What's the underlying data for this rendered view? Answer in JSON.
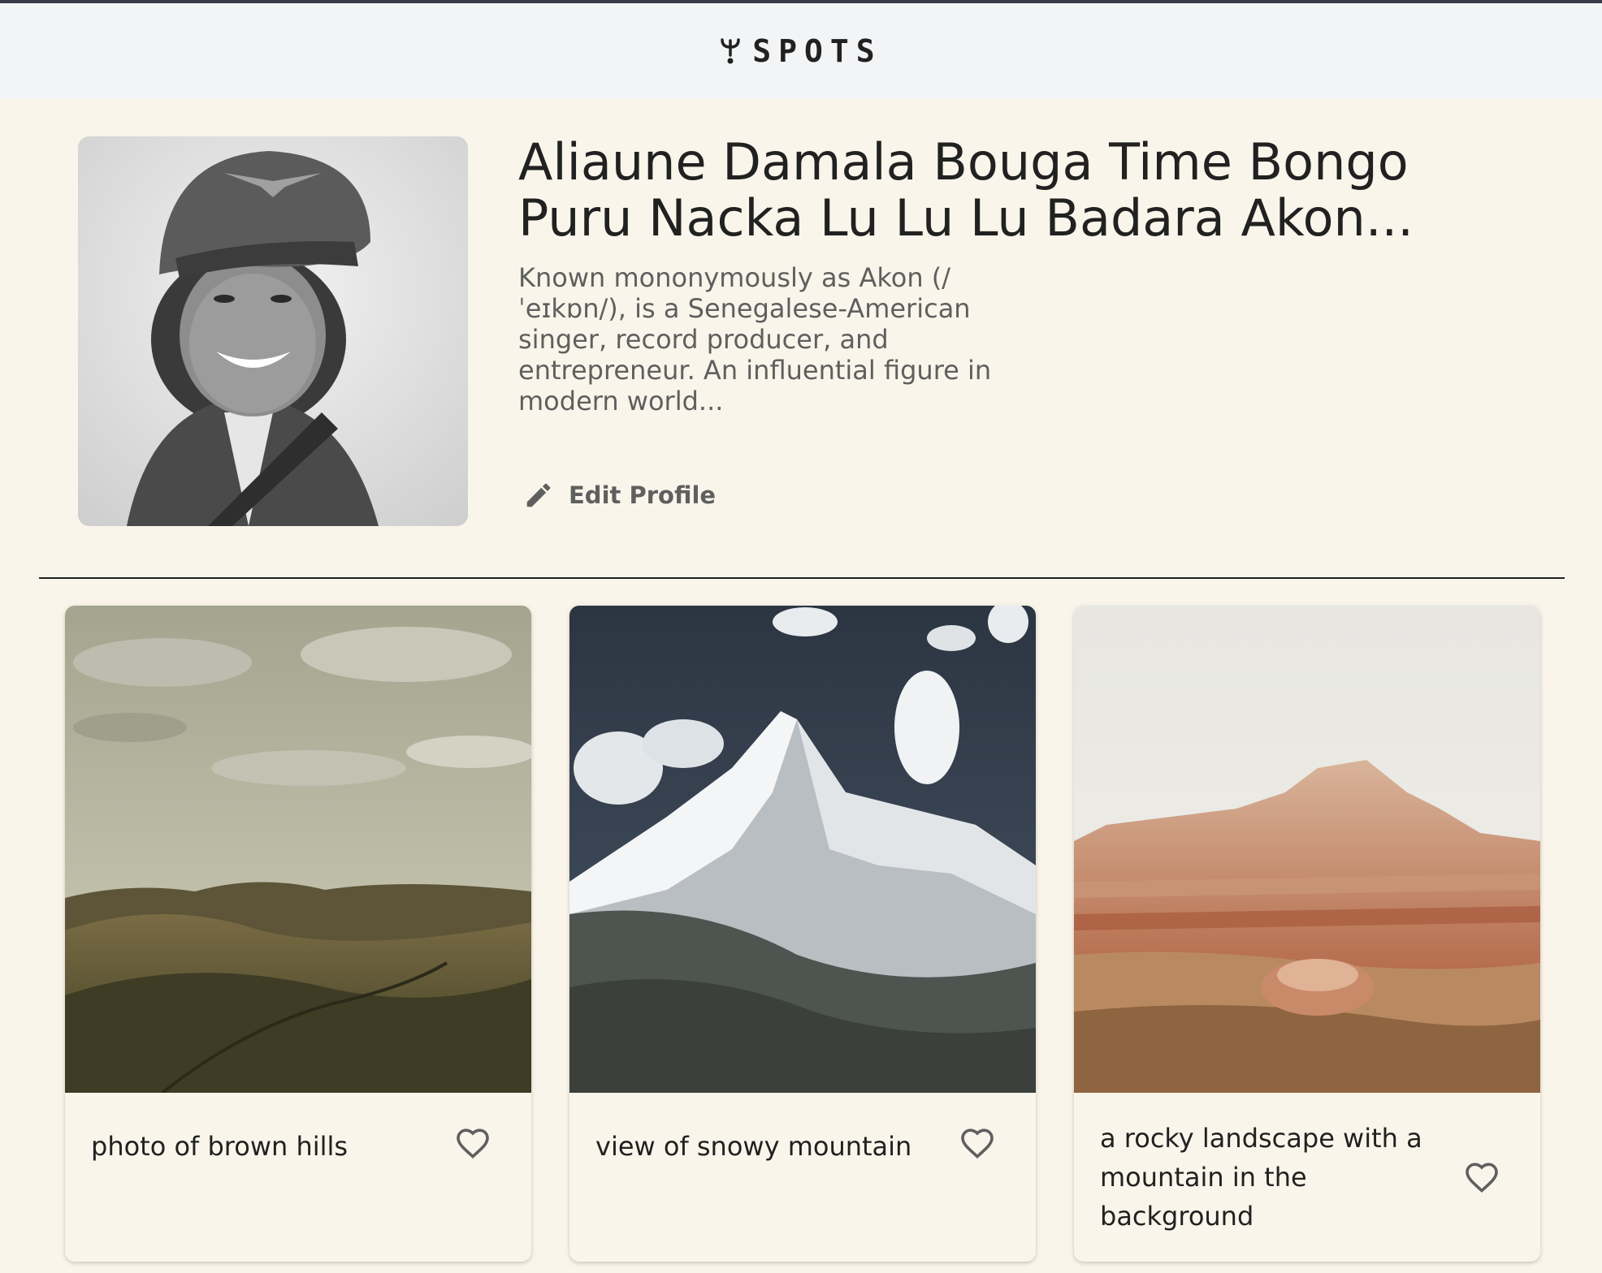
{
  "app": {
    "logo_text": "SPOTS",
    "logo_icon": "sprout-arrow-icon"
  },
  "profile": {
    "name": "Aliaune Damala Bouga Time Bongo Puru Nacka Lu Lu Lu Badara Akon...",
    "bio": "Known mononymously as Akon (/ˈeɪkɒn/), is a Senegalese-American singer, record producer, and entrepreneur. An influential figure in modern world...",
    "edit_label": "Edit Profile",
    "edit_icon": "pencil-icon"
  },
  "cards": [
    {
      "title": "photo of brown hills",
      "like_icon": "heart-outline-icon"
    },
    {
      "title": "view of snowy mountain",
      "like_icon": "heart-outline-icon"
    },
    {
      "title": "a rocky landscape with a mountain in the background",
      "like_icon": "heart-outline-icon"
    }
  ],
  "colors": {
    "page_bg": "#FAF5EA",
    "header_bg": "#F3F4F6",
    "text_primary": "#212121",
    "text_secondary": "#5F5F5F"
  }
}
